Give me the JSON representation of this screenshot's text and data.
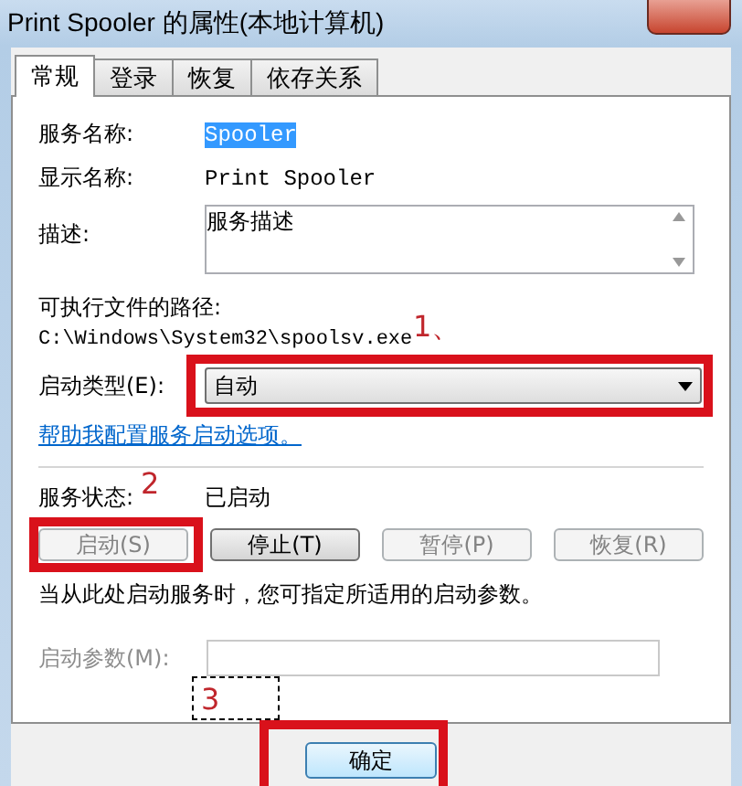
{
  "window": {
    "title": "Print Spooler 的属性(本地计算机)"
  },
  "tabs": [
    {
      "label": "常规",
      "selected": true
    },
    {
      "label": "登录",
      "selected": false
    },
    {
      "label": "恢复",
      "selected": false
    },
    {
      "label": "依存关系",
      "selected": false
    }
  ],
  "service_name": {
    "label": "服务名称:",
    "value": "Spooler",
    "selected": true
  },
  "display_name": {
    "label": "显示名称:",
    "value": "Print Spooler"
  },
  "description": {
    "label": "描述:",
    "value": "服务描述"
  },
  "executable": {
    "label": "可执行文件的路径:",
    "value": "C:\\Windows\\System32\\spoolsv.exe"
  },
  "startup_type": {
    "label": "启动类型(E):",
    "value": "自动",
    "annotation": "1、"
  },
  "help_link": "帮助我配置服务启动选项。",
  "status": {
    "label": "服务状态:",
    "value": "已启动"
  },
  "service_buttons": [
    {
      "label": "启动(S)",
      "disabled": true,
      "annotation": "2"
    },
    {
      "label": "停止(T)",
      "disabled": false
    },
    {
      "label": "暂停(P)",
      "disabled": true
    },
    {
      "label": "恢复(R)",
      "disabled": true
    }
  ],
  "hint": "当从此处启动服务时，您可指定所适用的启动参数。",
  "start_parameters": {
    "label": "启动参数(M):",
    "disabled": true
  },
  "buttons": [
    {
      "label": "确定",
      "annotation": "3"
    }
  ]
}
